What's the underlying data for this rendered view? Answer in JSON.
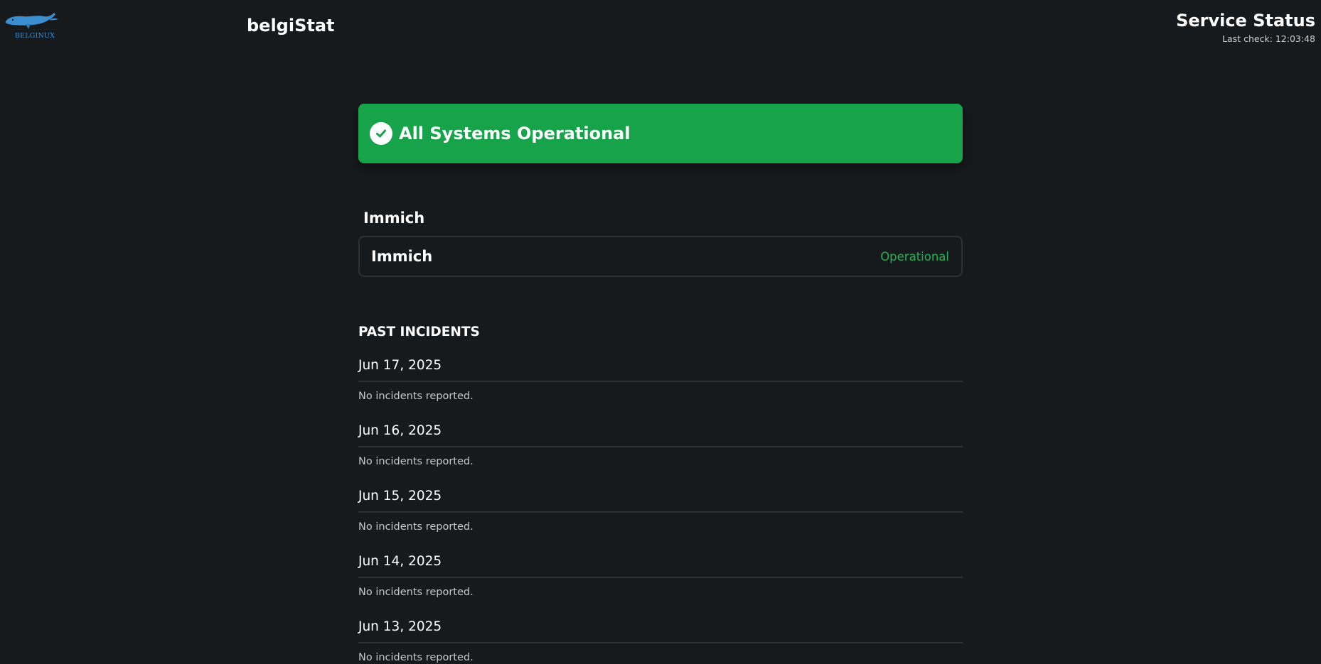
{
  "header": {
    "logo_text": "BELGINUX",
    "brand_name": "belgiStat",
    "page_title": "Service Status",
    "last_check": "Last check: 12:03:48"
  },
  "banner": {
    "text": "All Systems Operational",
    "color": "#16a34a",
    "icon": "check-circle-icon"
  },
  "group": {
    "title": "Immich",
    "services": [
      {
        "name": "Immich",
        "status": "Operational",
        "status_color": "#1fb355"
      }
    ]
  },
  "incidents": {
    "heading": "PAST INCIDENTS",
    "days": [
      {
        "date": "Jun 17, 2025",
        "note": "No incidents reported."
      },
      {
        "date": "Jun 16, 2025",
        "note": "No incidents reported."
      },
      {
        "date": "Jun 15, 2025",
        "note": "No incidents reported."
      },
      {
        "date": "Jun 14, 2025",
        "note": "No incidents reported."
      },
      {
        "date": "Jun 13, 2025",
        "note": "No incidents reported."
      }
    ]
  },
  "colors": {
    "background": "#171a1d",
    "logo": "#3b8fd0"
  }
}
